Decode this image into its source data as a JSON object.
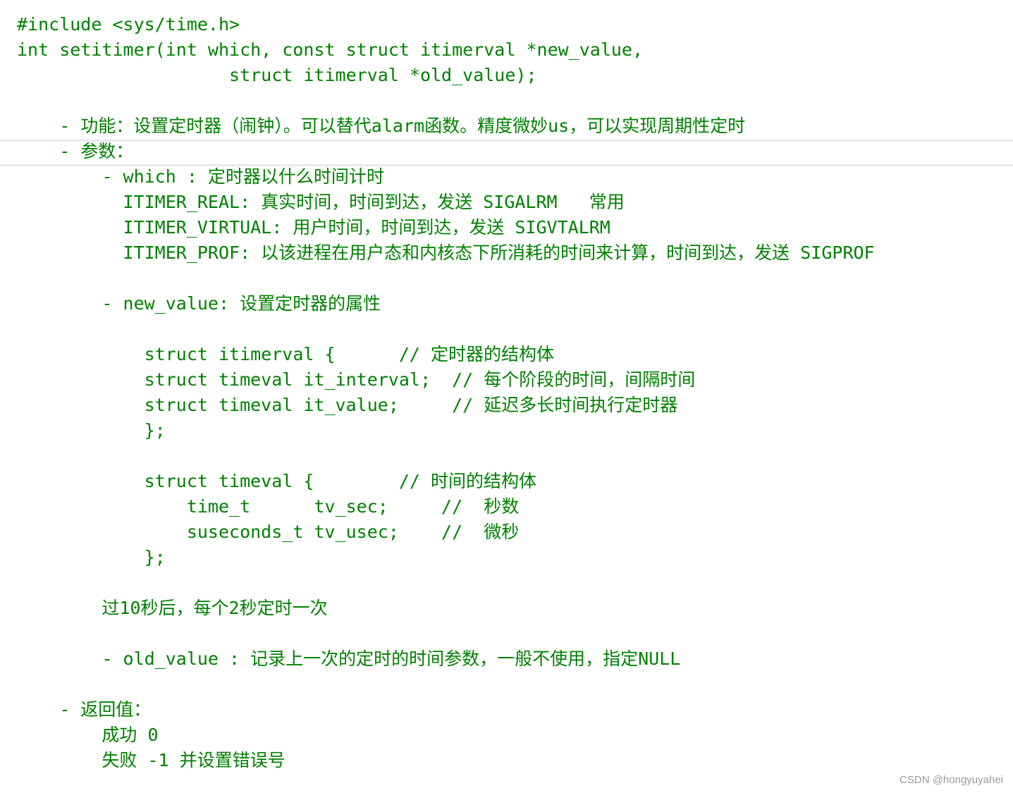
{
  "lines": [
    "#include <sys/time.h>",
    "int setitimer(int which, const struct itimerval *new_value,",
    "                    struct itimerval *old_value);",
    "",
    "    - 功能：设置定时器（闹钟）。可以替代alarm函数。精度微妙us，可以实现周期性定时",
    "    - 参数：",
    "        - which : 定时器以什么时间计时",
    "          ITIMER_REAL: 真实时间，时间到达，发送 SIGALRM   常用",
    "          ITIMER_VIRTUAL: 用户时间，时间到达，发送 SIGVTALRM",
    "          ITIMER_PROF: 以该进程在用户态和内核态下所消耗的时间来计算，时间到达，发送 SIGPROF",
    "",
    "        - new_value: 设置定时器的属性",
    "",
    "            struct itimerval {      // 定时器的结构体",
    "            struct timeval it_interval;  // 每个阶段的时间，间隔时间",
    "            struct timeval it_value;     // 延迟多长时间执行定时器",
    "            };",
    "",
    "            struct timeval {        // 时间的结构体",
    "                time_t      tv_sec;     //  秒数",
    "                suseconds_t tv_usec;    //  微秒",
    "            };",
    "",
    "        过10秒后，每个2秒定时一次",
    "",
    "        - old_value : 记录上一次的定时的时间参数，一般不使用，指定NULL",
    "",
    "    - 返回值：",
    "        成功 0",
    "        失败 -1 并设置错误号"
  ],
  "watermark": "CSDN @hongyuyahei",
  "colors": {
    "text": "#008000",
    "current_line_border": "#e8e8ef",
    "watermark": "#9a9a9a"
  }
}
